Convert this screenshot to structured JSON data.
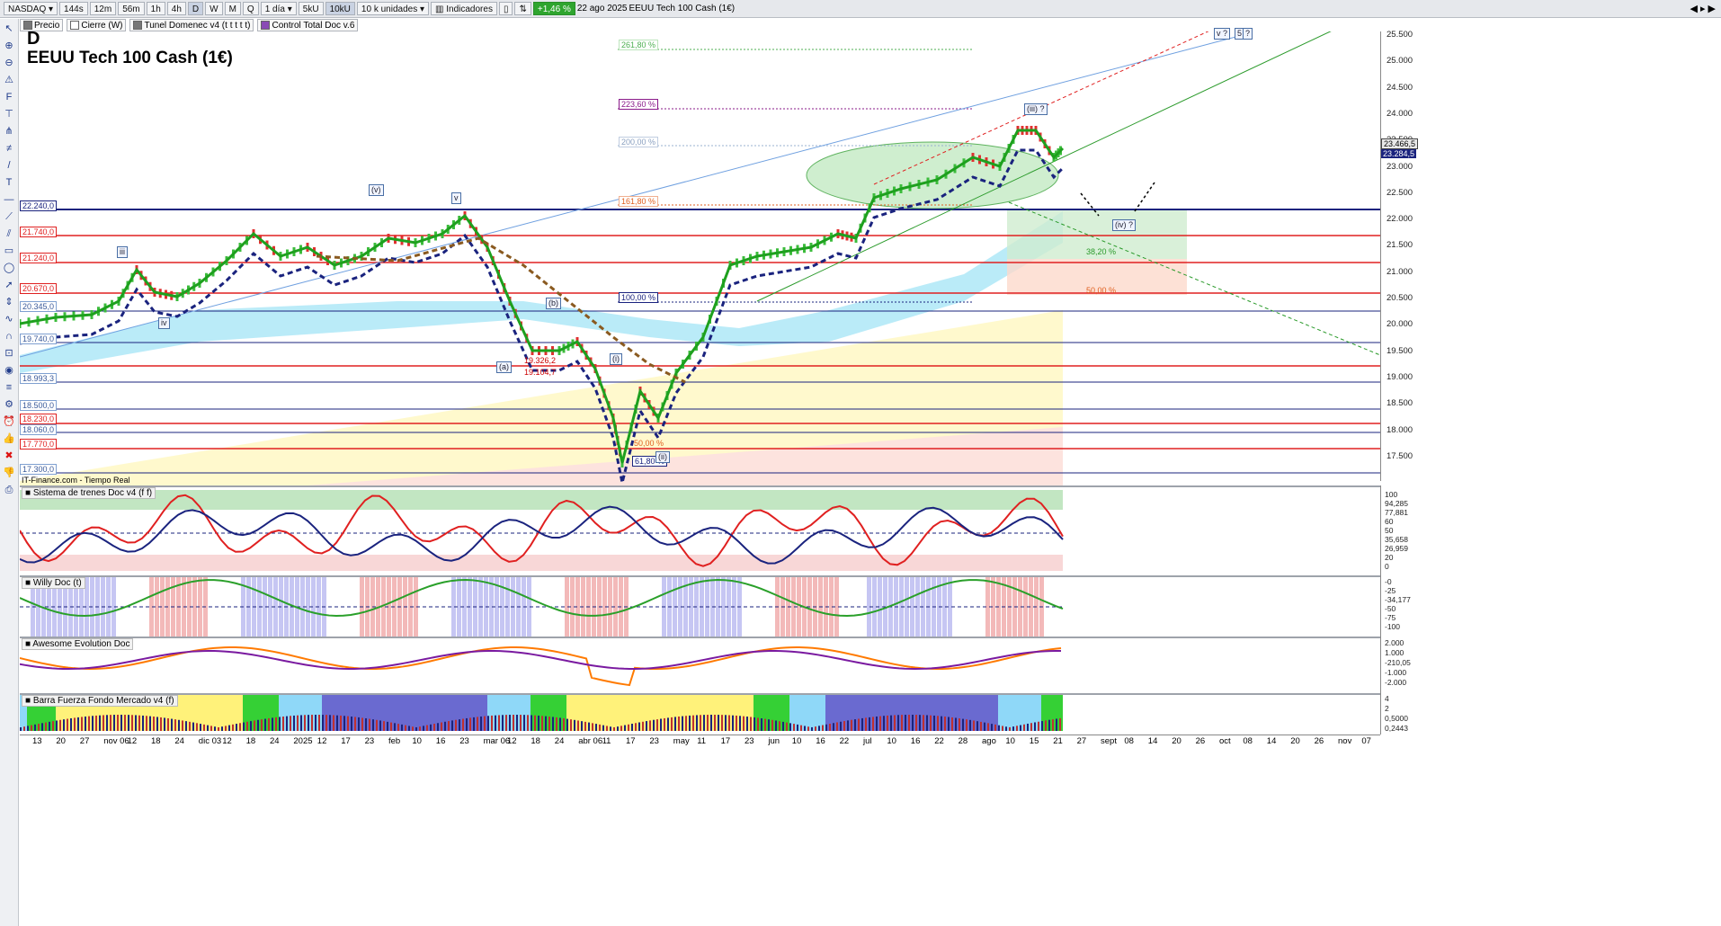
{
  "toolbar": {
    "symbol": "NASDAQ",
    "intervals": [
      "144s",
      "12m",
      "56m",
      "1h",
      "4h",
      "D",
      "W",
      "M",
      "Q"
    ],
    "active_interval": "D",
    "period": "1 día",
    "units": [
      "5kU",
      "10kU"
    ],
    "units_select": "10 k unidades",
    "indicators_label": "Indicadores",
    "change": "+1,46 %",
    "date": "22 ago 2025",
    "instrument": "EEUU Tech 100 Cash (1€)"
  },
  "toolbar2": {
    "items": [
      "Precio",
      "Cierre (W)",
      "Tunel Domenec v4 (t t t t t)",
      "Control Total Doc v.6"
    ]
  },
  "chart": {
    "timeframe_letter": "D",
    "title": "EEUU Tech 100 Cash (1€)",
    "source": "IT-Finance.com - Tiempo Real",
    "price_axis": [
      "25.500",
      "25.000",
      "24.500",
      "24.000",
      "23.500",
      "23.000",
      "22.500",
      "22.000",
      "21.500",
      "21.000",
      "20.500",
      "20.000",
      "19.500",
      "19.000",
      "18.500",
      "18.000",
      "17.500"
    ],
    "last_prices": [
      "23.466,5",
      "23.284,5"
    ],
    "levels": [
      {
        "label": "22.240,0",
        "color": "#1a237e"
      },
      {
        "label": "21.740,0",
        "color": "#e02020"
      },
      {
        "label": "21.240,0",
        "color": "#e02020"
      },
      {
        "label": "20.670,0",
        "color": "#e02020"
      },
      {
        "label": "20.345,0",
        "color": "#1a237e"
      },
      {
        "label": "19.740,0",
        "color": "#1a237e"
      },
      {
        "label": "18.993,3",
        "color": "#1a237e"
      },
      {
        "label": "18.500,0",
        "color": "#1a237e"
      },
      {
        "label": "18.230,0",
        "color": "#e02020"
      },
      {
        "label": "18.060,0",
        "color": "#1a237e"
      },
      {
        "label": "17.770,0",
        "color": "#e02020"
      },
      {
        "label": "17.300,0",
        "color": "#1a237e"
      }
    ],
    "fib": [
      "261,80 %",
      "223,60 %",
      "200,00 %",
      "161,80 %",
      "100,00 %",
      "61,80 %",
      "50,00 %",
      "38,20 %",
      "50,00 %"
    ],
    "waves": [
      "(v)",
      "v",
      "iii",
      "iv",
      "(a)",
      "(b)",
      "(i)",
      "(ii)",
      "(iii) ?",
      "(iv) ?",
      "v ?",
      "5",
      "?"
    ],
    "price_marks": [
      "19.326,2",
      "19.104,7"
    ]
  },
  "panels": [
    {
      "name": "Sistema de trenes Doc v4 (f f)",
      "axis": [
        "100",
        "94,285",
        "77,881",
        "60",
        "50",
        "35,658",
        "26,959",
        "20",
        "0"
      ]
    },
    {
      "name": "Willy Doc (t)",
      "axis": [
        "-0",
        "-25",
        "-34,177",
        "-50",
        "-75",
        "-100"
      ]
    },
    {
      "name": "Awesome Evolution Doc",
      "axis": [
        "2.000",
        "1.000",
        "-210,05",
        "-1.000",
        "-2.000"
      ]
    },
    {
      "name": "Barra Fuerza Fondo Mercado v4 (f)",
      "axis": [
        "4",
        "2",
        "0,5000",
        "0,2443"
      ]
    }
  ],
  "dates": [
    "13",
    "20",
    "27",
    "nov 06",
    "12",
    "18",
    "24",
    "dic 03",
    "12",
    "18",
    "24",
    "2025",
    "12",
    "17",
    "23",
    "feb",
    "10",
    "16",
    "23",
    "mar 06",
    "12",
    "18",
    "24",
    "abr 06",
    "11",
    "17",
    "23",
    "may",
    "11",
    "17",
    "23",
    "jun",
    "10",
    "16",
    "22",
    "jul",
    "10",
    "16",
    "22",
    "28",
    "ago",
    "10",
    "15",
    "21",
    "27",
    "sept",
    "08",
    "14",
    "20",
    "26",
    "oct",
    "08",
    "14",
    "20",
    "26",
    "nov",
    "07"
  ],
  "colors": {
    "up": "#22bb22",
    "down": "#dd2222",
    "blue": "#1a237e"
  }
}
